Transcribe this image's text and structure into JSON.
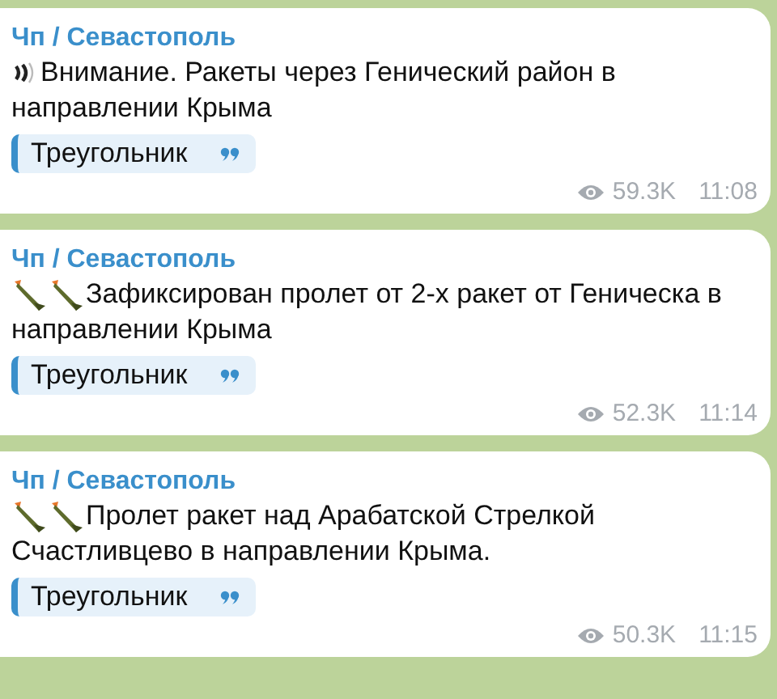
{
  "messages": [
    {
      "channel": "Чп / Севастополь",
      "kind": "sound",
      "lines": [
        "Внимание. Ракеты через Генический район в",
        "направлении Крыма"
      ],
      "quote": "Треугольник",
      "views": "59.3K",
      "time": "11:08"
    },
    {
      "channel": "Чп / Севастополь",
      "kind": "rockets",
      "lines": [
        "Зафиксирован пролет от 2-х ракет от Геническа в",
        "направлении Крыма"
      ],
      "quote": "Треугольник",
      "views": "52.3K",
      "time": "11:14"
    },
    {
      "channel": "Чп / Севастополь",
      "kind": "rockets",
      "lines": [
        "Пролет ракет над Арабатской Стрелкой",
        "Счастливцево в направлении Крыма."
      ],
      "quote": "Треугольник",
      "views": "50.3K",
      "time": "11:15"
    }
  ]
}
